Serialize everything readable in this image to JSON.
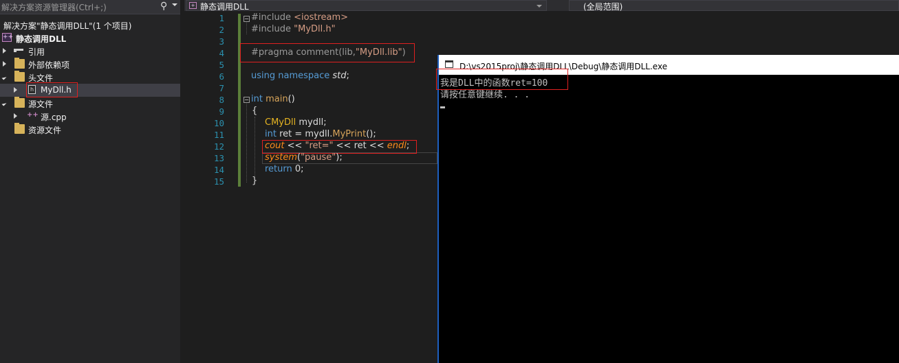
{
  "solution_explorer": {
    "search_placeholder": "解决方案资源管理器(Ctrl+;)",
    "solution_label": "解决方案\"静态调用DLL\"(1 个项目)",
    "project": "静态调用DLL",
    "items": [
      {
        "label": "引用"
      },
      {
        "label": "外部依赖项"
      },
      {
        "label": "头文件"
      },
      {
        "label": "MyDll.h"
      },
      {
        "label": "源文件"
      },
      {
        "label": "源.cpp"
      },
      {
        "label": "资源文件"
      }
    ]
  },
  "navbar": {
    "project_combo": "静态调用DLL",
    "scope_combo": "(全局范围)"
  },
  "editor": {
    "line_numbers": [
      "1",
      "2",
      "3",
      "4",
      "5",
      "6",
      "7",
      "8",
      "9",
      "10",
      "11",
      "12",
      "13",
      "14",
      "15"
    ],
    "lines": {
      "l1_pp": "#include ",
      "l1_inc": "<iostream>",
      "l2_pp": "#include ",
      "l2_inc": "\"MyDll.h\"",
      "l4_pp": "#pragma comment(lib,",
      "l4_str": "\"MyDll.lib\"",
      "l4_end": ")",
      "l6_kw": "using namespace ",
      "l6_ns": "std",
      "l6_end": ";",
      "l8_kw": "int ",
      "l8_fn": "main",
      "l8_end": "()",
      "l9": "{",
      "l10_cls": "CMyDll",
      "l10_end": " mydll;",
      "l11_kw": "int",
      "l11_mid": " ret = mydll.",
      "l11_fn": "MyPrint",
      "l11_end": "();",
      "l12_cout": "cout",
      "l12_a": " << ",
      "l12_str": "\"ret=\"",
      "l12_b": " << ret << ",
      "l12_endl": "endl",
      "l12_end": ";",
      "l13_sys": "system",
      "l13_a": "(",
      "l13_str": "\"pause\"",
      "l13_end": ");",
      "l14_kw": "return",
      "l14_end": " 0;",
      "l15": "}"
    }
  },
  "console": {
    "title": "D:\\vs2015proj\\静态调用DLL\\Debug\\静态调用DLL.exe",
    "line1": "我是DLL中的函数ret=100",
    "line2": "请按任意键继续. . ."
  },
  "colors": {
    "highlight_box": "#e02020",
    "change_bar": "#5b7f3a",
    "console_border": "#1e5fbf"
  }
}
